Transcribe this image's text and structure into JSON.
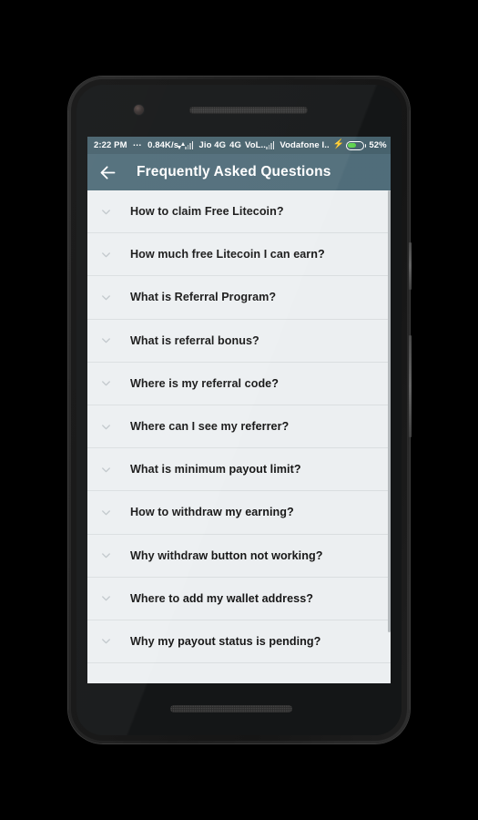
{
  "status_bar": {
    "time": "2:22 PM",
    "overflow_dots": "…",
    "data_speed": "0.84K/s",
    "data_transfer_icon": "data-transfer-icon",
    "signal_icon_1": "signal-bars-icon",
    "carrier_1": "Jio 4G",
    "network_type": "4G",
    "volte_label": "VoL..",
    "signal_icon_2": "signal-bars-icon",
    "carrier_2": "Vodafone I..",
    "charging_icon": "charging-bolt-icon",
    "battery_icon": "battery-icon",
    "battery_percent": "52%",
    "battery_level": 52,
    "background_color": "#45606b"
  },
  "app_bar": {
    "back_icon": "back-arrow-icon",
    "title": "Frequently Asked Questions",
    "background_color": "#4e6b78",
    "text_color": "#ffffff"
  },
  "faq": {
    "expand_icon": "chevron-down-icon",
    "items": [
      {
        "question": "How to claim Free Litecoin?"
      },
      {
        "question": "How much free Litecoin I can earn?"
      },
      {
        "question": "What is Referral Program?"
      },
      {
        "question": "What is referral bonus?"
      },
      {
        "question": "Where is my referral code?"
      },
      {
        "question": "Where can I see my referrer?"
      },
      {
        "question": "What is minimum payout limit?"
      },
      {
        "question": "How to withdraw my earning?"
      },
      {
        "question": "Why withdraw button not working?"
      },
      {
        "question": "Where to add my wallet address?"
      },
      {
        "question": "Why my payout status is pending?"
      }
    ],
    "background_color": "#eceff1",
    "divider_color": "#dadee0",
    "text_color": "#141414"
  },
  "device": {
    "front_camera": "front-camera-icon",
    "earpiece": "earpiece-speaker",
    "bottom_speaker": "bottom-speaker",
    "power_button": "power-button",
    "volume_button": "volume-rocker-button",
    "frame_color": "#1d1d1d"
  }
}
